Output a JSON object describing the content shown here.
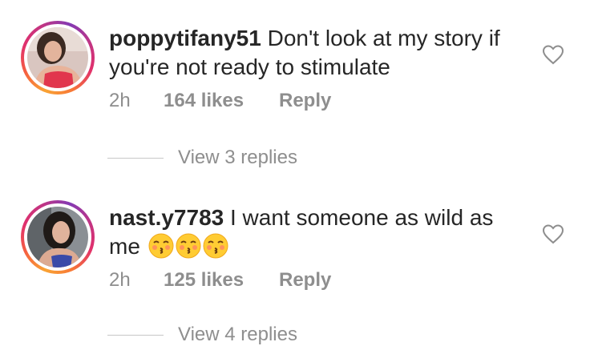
{
  "comments": [
    {
      "username": "poppytifany51",
      "text": "Don't look at my story if you're not ready to stimulate",
      "time": "2h",
      "likes": "164 likes",
      "reply": "Reply",
      "view_replies": "View 3 replies"
    },
    {
      "username": "nast.y7783",
      "text": "I want someone as wild as me",
      "emojis": [
        "kissing-face-with-closed-eyes",
        "kissing-face-with-closed-eyes",
        "kissing-face-with-closed-eyes"
      ],
      "time": "2h",
      "likes": "125 likes",
      "reply": "Reply",
      "view_replies": "View 4 replies"
    }
  ],
  "colors": {
    "text": "#262626",
    "secondary": "#8e8e8e",
    "ring_gradient": [
      "#f9a334",
      "#e1306c",
      "#833ab4"
    ]
  }
}
